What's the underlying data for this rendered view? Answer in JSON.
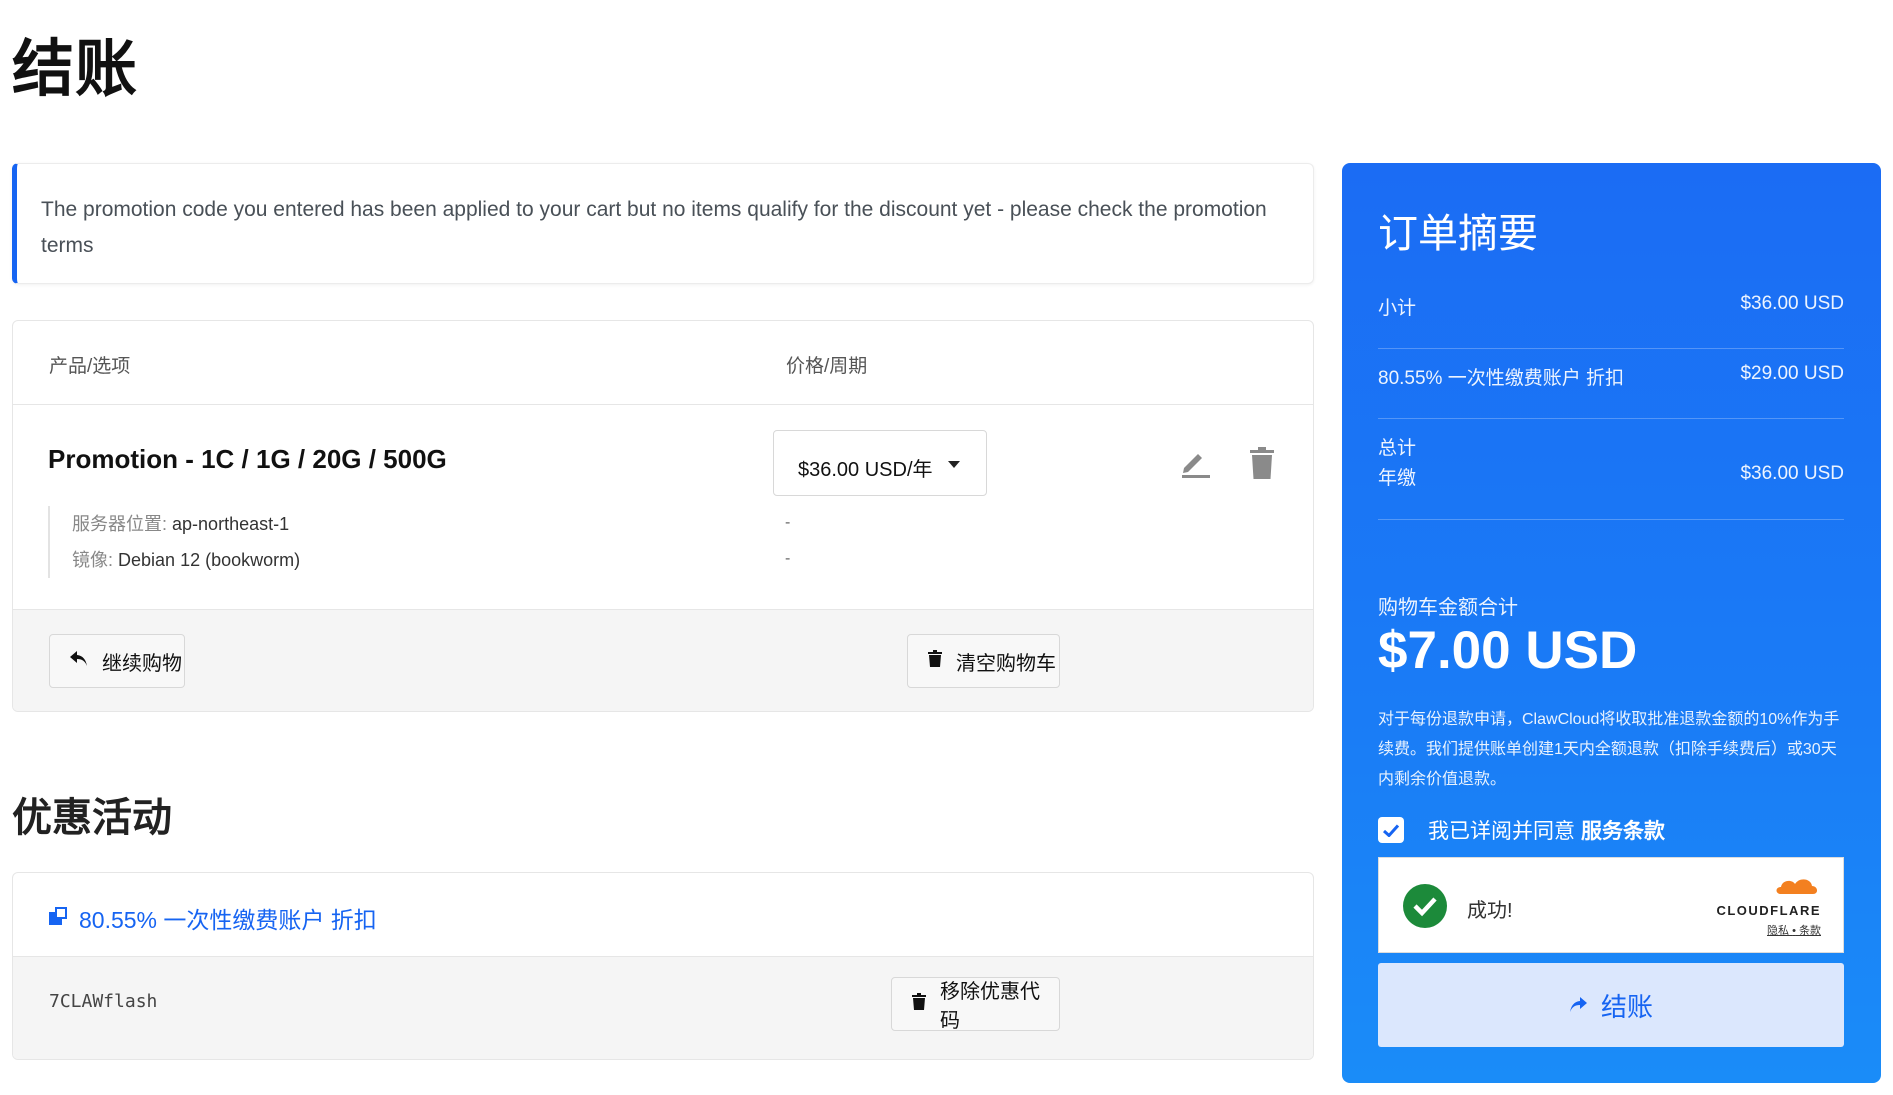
{
  "page": {
    "title": "结账"
  },
  "alert": {
    "message": "The promotion code you entered has been applied to your cart but no items qualify for the discount yet - please check the promotion terms"
  },
  "cart": {
    "headers": {
      "product": "产品/选项",
      "price": "价格/周期"
    },
    "item": {
      "name": "Promotion - 1C / 1G / 20G / 500G",
      "price_cycle": "$36.00 USD/年",
      "options": [
        {
          "label": "服务器位置:",
          "value": "ap-northeast-1",
          "price": "-"
        },
        {
          "label": "镜像:",
          "value": "Debian 12 (bookworm)",
          "price": "-"
        }
      ]
    },
    "continue_label": "继续购物",
    "empty_label": "清空购物车"
  },
  "promotions": {
    "title": "优惠活动",
    "label": "80.55% 一次性缴费账户 折扣",
    "code": "7CLAWflash",
    "remove_label": "移除优惠代码"
  },
  "summary": {
    "title": "订单摘要",
    "subtotal_label": "小计",
    "subtotal_value": "$36.00 USD",
    "discount_label": "80.55% 一次性缴费账户 折扣",
    "discount_value": "$29.00 USD",
    "totals_label": "总计",
    "annual_label": "年缴",
    "annual_value": "$36.00 USD",
    "cart_total_label": "购物车金额合计",
    "cart_total_value": "$7.00 USD",
    "refund_note": "对于每份退款申请，ClawCloud将收取批准退款金额的10%作为手续费。我们提供账单创建1天内全额退款（扣除手续费后）或30天内剩余价值退款。",
    "agree_text": "我已详阅并同意",
    "terms_link": "服务条款",
    "agree_checked": true,
    "captcha_status": "成功!",
    "captcha_brand": "CLOUDFLARE",
    "captcha_privacy": "隐私",
    "captcha_separator": "•",
    "captcha_terms": "条款",
    "checkout_label": "结账"
  },
  "colors": {
    "primary": "#1664f2",
    "success": "#1c8a3a",
    "cloudflare": "#f38020"
  }
}
